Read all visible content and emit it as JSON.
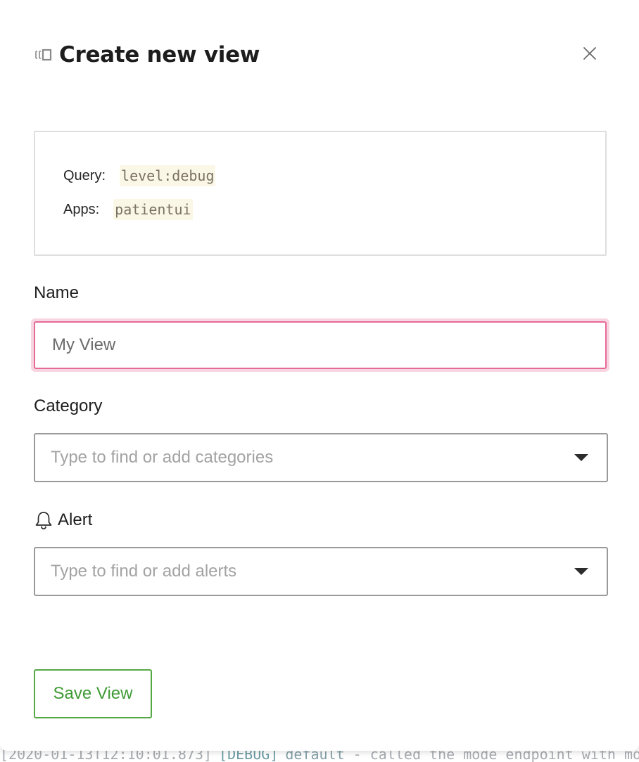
{
  "modal": {
    "title": "Create new view",
    "title_icon": "view-icon",
    "close_icon": "close-icon"
  },
  "summary": {
    "query_label": "Query:",
    "query_value": "level:debug",
    "apps_label": "Apps:",
    "apps_value": "patientui"
  },
  "form": {
    "name_label": "Name",
    "name_placeholder": "My View",
    "name_value": "",
    "category_label": "Category",
    "category_placeholder": "Type to find or add categories",
    "alert_label": "Alert",
    "alert_icon": "bell-icon",
    "alert_placeholder": "Type to find or add alerts",
    "dropdown_icon": "caret-down-icon"
  },
  "actions": {
    "save_label": "Save View"
  },
  "background_log": {
    "timestamp": "[2020-01-13T12:10:01.873]",
    "level": "[DEBUG]",
    "source": "default",
    "message": "- called the mode endpoint with mo"
  },
  "colors": {
    "input_focus_border": "#e66a97",
    "input_focus_ring": "#f7d6e1",
    "save_button_green": "#3f9a35",
    "code_chip_background": "#fbf7e6"
  }
}
